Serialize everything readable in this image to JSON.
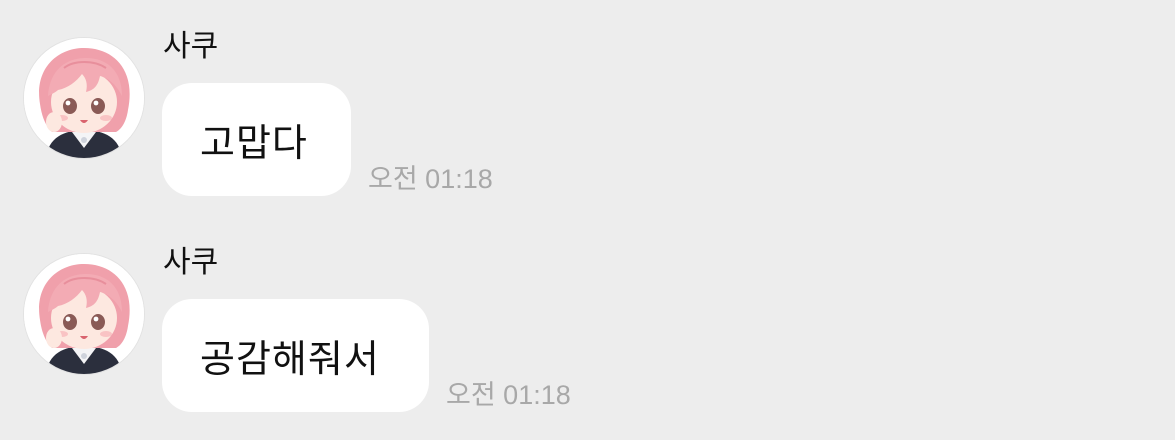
{
  "messages": [
    {
      "sender": "사쿠",
      "avatar_icon": "pink-hair-chibi-avatar",
      "text": "고맙다",
      "time": "오전 01:18"
    },
    {
      "sender": "사쿠",
      "avatar_icon": "pink-hair-chibi-avatar",
      "text": "공감해줘서",
      "time": "오전 01:18"
    }
  ],
  "colors": {
    "background": "#ededed",
    "bubble": "#ffffff",
    "time_text": "#a8a8a8",
    "avatar_hair": "#f2a7b0"
  }
}
